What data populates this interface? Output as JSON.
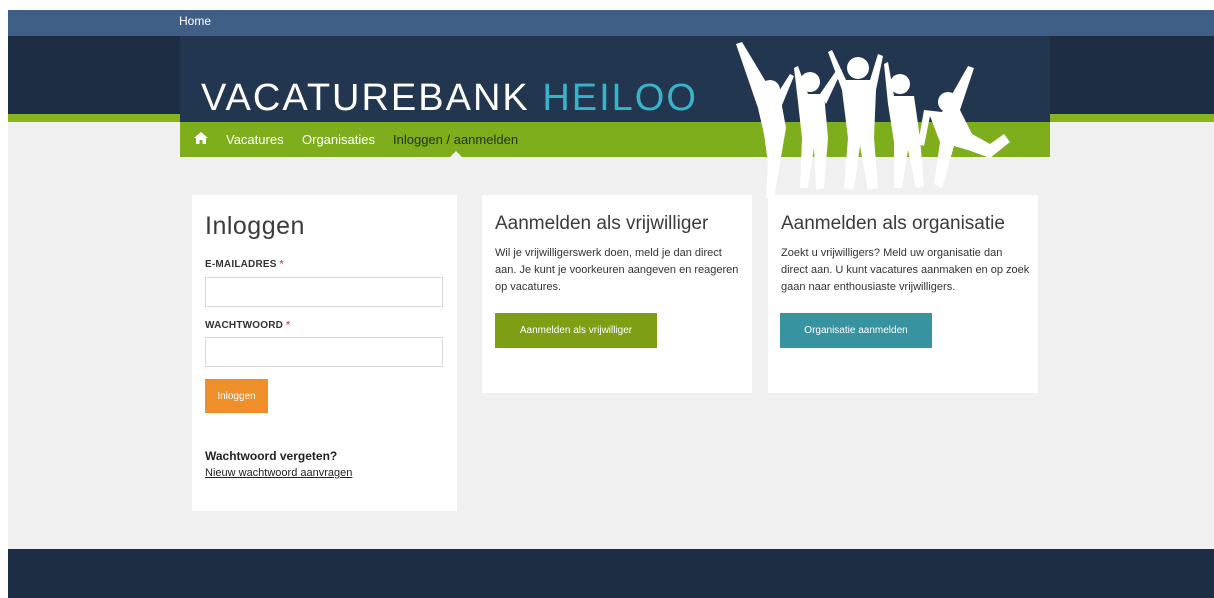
{
  "topbar": {
    "home_label": "Home"
  },
  "header": {
    "logo_part1": "VACATUREBANK",
    "logo_part2": "HEILOO"
  },
  "nav": {
    "items": [
      {
        "label": "Vacatures"
      },
      {
        "label": "Organisaties"
      },
      {
        "label": "Inloggen / aanmelden"
      }
    ]
  },
  "login": {
    "title": "Inloggen",
    "email_label": "E-MAILADRES",
    "password_label": "WACHTWOORD",
    "required_marker": "*",
    "email_value": "",
    "password_value": "",
    "submit_label": "Inloggen",
    "forgot_title": "Wachtwoord vergeten?",
    "forgot_link": "Nieuw wachtwoord aanvragen"
  },
  "volunteer": {
    "title": "Aanmelden als vrijwilliger",
    "text": "Wil je vrijwilligerswerk doen, meld je dan direct aan. Je kunt je voorkeuren aangeven en reageren op vacatures.",
    "button": "Aanmelden als vrijwilliger"
  },
  "organisation": {
    "title": "Aanmelden als organisatie",
    "text": "Zoekt u vrijwilligers? Meld uw organisatie dan direct aan. U kunt vacatures aanmaken en op zoek gaan naar enthousiaste vrijwilligers.",
    "button": "Organisatie aanmelden"
  },
  "colors": {
    "header_dark": "#1d2d43",
    "topbar": "#3f5f86",
    "nav_green": "#7fae1c",
    "logo_accent": "#39b3c9",
    "login_button": "#ef8f2a",
    "volunteer_button": "#7e9e14",
    "organisation_button": "#37939f"
  },
  "icons": {
    "nav_home": "home-icon"
  }
}
